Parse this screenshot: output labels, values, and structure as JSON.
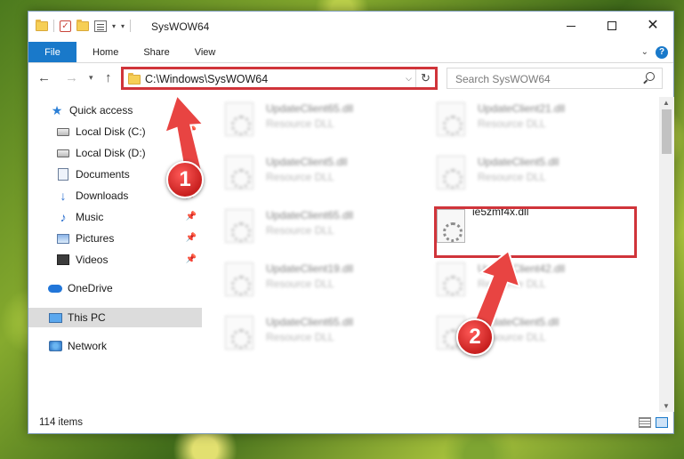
{
  "window": {
    "title": "SysWOW64",
    "minimize_glyph": "",
    "maximize_glyph": "",
    "close_glyph": "✕"
  },
  "ribbon": {
    "tabs": [
      {
        "label": "File"
      },
      {
        "label": "Home"
      },
      {
        "label": "Share"
      },
      {
        "label": "View"
      }
    ],
    "help_glyph": "?"
  },
  "nav": {
    "address": "C:\\Windows\\SysWOW64",
    "search_placeholder": "Search SysWOW64"
  },
  "sidebar": {
    "items": [
      {
        "label": "Quick access",
        "icon": "star-icon"
      },
      {
        "label": "Local Disk (C:)",
        "icon": "drive-icon",
        "pinned": true
      },
      {
        "label": "Local Disk (D:)",
        "icon": "drive-icon",
        "pinned": true
      },
      {
        "label": "Documents",
        "icon": "documents-icon",
        "pinned": true
      },
      {
        "label": "Downloads",
        "icon": "downloads-icon",
        "pinned": true
      },
      {
        "label": "Music",
        "icon": "music-icon",
        "pinned": true
      },
      {
        "label": "Pictures",
        "icon": "pictures-icon",
        "pinned": true
      },
      {
        "label": "Videos",
        "icon": "videos-icon",
        "pinned": true
      },
      {
        "label": "OneDrive",
        "icon": "onedrive-icon"
      },
      {
        "label": "This PC",
        "icon": "this-pc-icon",
        "selected": true
      },
      {
        "label": "Network",
        "icon": "network-icon"
      }
    ]
  },
  "files": [
    {
      "name": "UpdateClient65.dll",
      "type": "Resource DLL"
    },
    {
      "name": "UpdateClient21.dll",
      "type": "Resource DLL"
    },
    {
      "name": "UpdateClient5.dll",
      "type": "Resource DLL"
    },
    {
      "name": "UpdateClient5.dll",
      "type": "Resource DLL"
    },
    {
      "name": "UpdateClient65.dll",
      "type": "Resource DLL"
    },
    {
      "name": "ie5zmf4x.dll",
      "type": ""
    },
    {
      "name": "UpdateClient19.dll",
      "type": "Resource DLL"
    },
    {
      "name": "UpdateClient42.dll",
      "type": "Resource DLL"
    },
    {
      "name": "UpdateClient65.dll",
      "type": "Resource DLL"
    },
    {
      "name": "UpdateClient5.dll",
      "type": "Resource DLL"
    }
  ],
  "status": {
    "item_count": "114 items"
  },
  "annotations": {
    "step1": "1",
    "step2": "2",
    "color": "#d0343a"
  }
}
